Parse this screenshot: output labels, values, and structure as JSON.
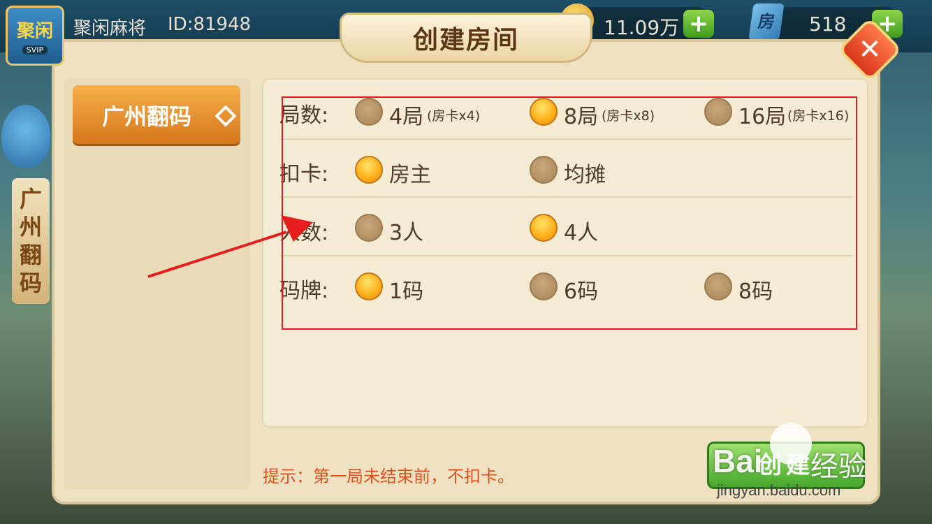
{
  "header": {
    "logo_text": "聚闲",
    "logo_badge": "SVIP",
    "username": "聚闲麻将",
    "user_id": "ID:81948",
    "coins": "11.09万",
    "room_cards": "518",
    "card_icon_glyph": "房",
    "plus_label": "+"
  },
  "side_tab": {
    "label": "广州翻码"
  },
  "dialog": {
    "title": "创建房间",
    "close_label": "✕",
    "game_tab": "广州翻码",
    "tip": "提示：第一局未结束前，不扣卡。",
    "create_label": "创建"
  },
  "options": {
    "rounds": {
      "label": "局数:",
      "choices": [
        {
          "text": "4局",
          "sub": "(房卡x4)",
          "selected": false
        },
        {
          "text": "8局",
          "sub": "(房卡x8)",
          "selected": true
        },
        {
          "text": "16局",
          "sub": "(房卡x16)",
          "selected": false
        }
      ]
    },
    "deduct": {
      "label": "扣卡:",
      "choices": [
        {
          "text": "房主",
          "selected": true
        },
        {
          "text": "均摊",
          "selected": false
        }
      ]
    },
    "players": {
      "label": "人数:",
      "choices": [
        {
          "text": "3人",
          "selected": false
        },
        {
          "text": "4人",
          "selected": true
        }
      ]
    },
    "horse": {
      "label": "码牌:",
      "choices": [
        {
          "text": "1码",
          "selected": true
        },
        {
          "text": "6码",
          "selected": false
        },
        {
          "text": "8码",
          "selected": false
        }
      ]
    }
  },
  "watermark": {
    "logo": "Bai",
    "name": "经验",
    "url": "jingyan.baidu.com"
  },
  "colors": {
    "highlight": "#e51d1d",
    "tip": "#e34f1c",
    "selected_radio": "#ffb21c"
  }
}
